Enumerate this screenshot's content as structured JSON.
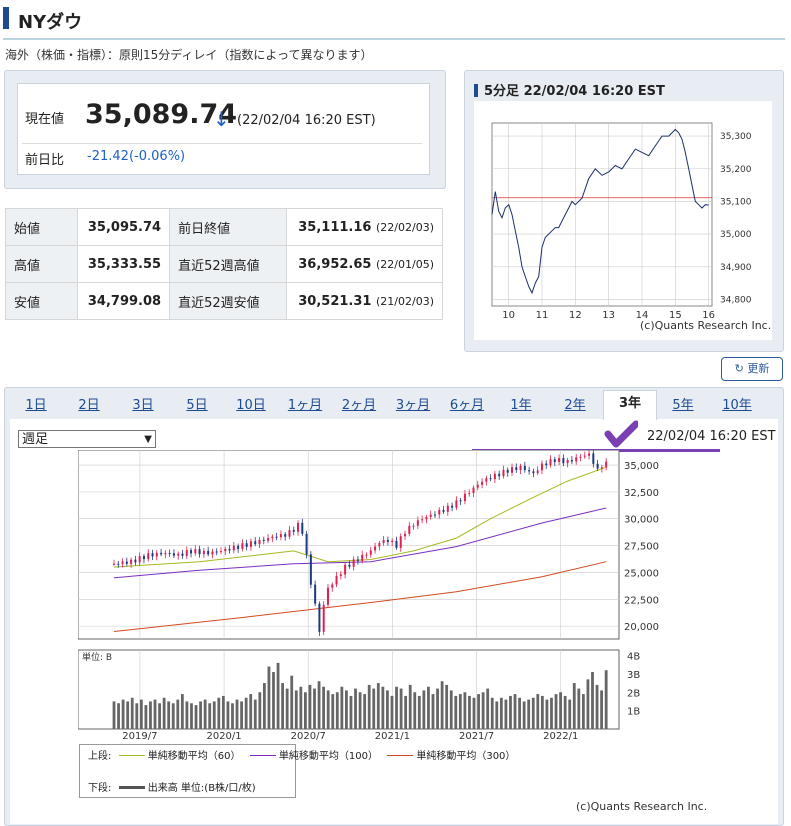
{
  "header": {
    "title": "NYダウ"
  },
  "note": "海外（株価・指標）：原則15分ディレイ（指数によって異なります）",
  "price": {
    "label_current": "現在値",
    "value": "35,089.74",
    "arrow": "↓",
    "timestamp": "(22/02/04 16:20 EST)",
    "label_change": "前日比",
    "change": "-21.42",
    "change_pct": "(-0.06%)"
  },
  "stats": {
    "open_label": "始値",
    "open": "35,095.74",
    "prev_close_label": "前日終値",
    "prev_close": "35,111.16",
    "prev_close_date": "(22/02/03)",
    "high_label": "高値",
    "high": "35,333.55",
    "high52_label": "直近52週高値",
    "high52": "36,952.65",
    "high52_date": "(22/01/05)",
    "low_label": "安値",
    "low": "34,799.08",
    "low52_label": "直近52週安値",
    "low52": "30,521.31",
    "low52_date": "(21/02/03)"
  },
  "mini": {
    "title": "5分足 22/02/04 16:20 EST",
    "copyright": "(c)Quants Research Inc."
  },
  "refresh_label": "更新",
  "tabs": [
    "1日",
    "2日",
    "3日",
    "5日",
    "10日",
    "1ヶ月",
    "2ヶ月",
    "3ヶ月",
    "6ヶ月",
    "1年",
    "2年",
    "3年",
    "5年",
    "10年"
  ],
  "active_tab": "3年",
  "period_select": "週足",
  "main_timestamp": "22/02/04 16:20 EST",
  "unit_label": "単位: B",
  "legend": {
    "upper": "上段:",
    "ma60": "単純移動平均（60）",
    "ma100": "単純移動平均（100）",
    "ma300": "単純移動平均（300）",
    "lower": "下段:",
    "volume": "出来高 単位:(B株/口/枚)"
  },
  "main_copyright": "(c)Quants Research Inc.",
  "colors": {
    "accent": "#1e4a8f",
    "up": "#e0204f",
    "down": "#1c3a80",
    "ma60": "#a8b820",
    "ma100": "#7a2fc0",
    "ma300": "#d24a1e",
    "mark": "#7a3fb2"
  },
  "chart_data": [
    {
      "type": "line",
      "title": "5分足 22/02/04 16:20 EST",
      "x": [
        9.5,
        9.6,
        9.7,
        9.8,
        9.9,
        10.0,
        10.1,
        10.2,
        10.3,
        10.4,
        10.5,
        10.6,
        10.7,
        10.8,
        10.9,
        11.0,
        11.1,
        11.2,
        11.3,
        11.4,
        11.5,
        11.6,
        11.7,
        11.8,
        11.9,
        12.0,
        12.2,
        12.4,
        12.6,
        12.8,
        13.0,
        13.2,
        13.4,
        13.6,
        13.8,
        14.0,
        14.2,
        14.4,
        14.6,
        14.8,
        15.0,
        15.1,
        15.2,
        15.3,
        15.4,
        15.5,
        15.6,
        15.7,
        15.8,
        15.9,
        16.0
      ],
      "values": [
        35060,
        35130,
        35070,
        35050,
        35080,
        35090,
        35060,
        35010,
        34960,
        34900,
        34870,
        34840,
        34820,
        34850,
        34870,
        34960,
        34990,
        35000,
        35010,
        35020,
        35020,
        35040,
        35060,
        35080,
        35100,
        35090,
        35110,
        35170,
        35200,
        35180,
        35190,
        35210,
        35200,
        35230,
        35260,
        35250,
        35240,
        35270,
        35300,
        35300,
        35320,
        35310,
        35290,
        35250,
        35200,
        35150,
        35100,
        35090,
        35080,
        35090,
        35089
      ],
      "reference_line": 35111.16,
      "xticks": [
        "10",
        "11",
        "12",
        "13",
        "14",
        "15",
        "16"
      ],
      "yticks": [
        "35,300",
        "35,200",
        "35,100",
        "35,000",
        "34,900",
        "34,800"
      ],
      "ylim": [
        34780,
        35340
      ]
    },
    {
      "type": "candlestick",
      "xticks": [
        "2019/7",
        "2020/1",
        "2020/7",
        "2021/1",
        "2021/7",
        "2022/1"
      ],
      "yticks": [
        "35,000",
        "32,500",
        "30,000",
        "27,500",
        "25,000",
        "22,500",
        "20,000"
      ],
      "ylim": [
        18800,
        36400
      ],
      "price_points": [
        [
          0,
          25800
        ],
        [
          8,
          26000
        ],
        [
          16,
          26600
        ],
        [
          24,
          26800
        ],
        [
          30,
          26600
        ],
        [
          36,
          27000
        ],
        [
          44,
          26800
        ],
        [
          52,
          27100
        ],
        [
          60,
          27500
        ],
        [
          68,
          27900
        ],
        [
          74,
          28300
        ],
        [
          80,
          28500
        ],
        [
          84,
          29000
        ],
        [
          86,
          29400
        ],
        [
          88,
          28800
        ],
        [
          90,
          26500
        ],
        [
          92,
          24000
        ],
        [
          94,
          22000
        ],
        [
          96,
          19500
        ],
        [
          98,
          22000
        ],
        [
          100,
          23500
        ],
        [
          104,
          24500
        ],
        [
          108,
          25500
        ],
        [
          112,
          26000
        ],
        [
          116,
          26500
        ],
        [
          120,
          27000
        ],
        [
          124,
          27800
        ],
        [
          128,
          28000
        ],
        [
          132,
          27500
        ],
        [
          136,
          28800
        ],
        [
          140,
          29500
        ],
        [
          144,
          30000
        ],
        [
          150,
          30500
        ],
        [
          156,
          31000
        ],
        [
          160,
          31500
        ],
        [
          166,
          32500
        ],
        [
          172,
          33500
        ],
        [
          178,
          34000
        ],
        [
          184,
          34500
        ],
        [
          190,
          34800
        ],
        [
          196,
          34200
        ],
        [
          200,
          35000
        ],
        [
          206,
          35500
        ],
        [
          212,
          35300
        ],
        [
          218,
          35800
        ],
        [
          222,
          36000
        ],
        [
          226,
          34500
        ],
        [
          228,
          35000
        ],
        [
          230,
          35100
        ]
      ],
      "ma60": [
        [
          0,
          25500
        ],
        [
          40,
          26000
        ],
        [
          84,
          27000
        ],
        [
          100,
          26000
        ],
        [
          120,
          26200
        ],
        [
          140,
          27000
        ],
        [
          160,
          28200
        ],
        [
          176,
          30000
        ],
        [
          196,
          32000
        ],
        [
          212,
          33500
        ],
        [
          230,
          34800
        ]
      ],
      "ma100": [
        [
          0,
          24500
        ],
        [
          40,
          25200
        ],
        [
          84,
          25800
        ],
        [
          120,
          26000
        ],
        [
          160,
          27400
        ],
        [
          200,
          29600
        ],
        [
          230,
          31000
        ]
      ],
      "ma300": [
        [
          0,
          19500
        ],
        [
          60,
          20800
        ],
        [
          120,
          22200
        ],
        [
          160,
          23200
        ],
        [
          200,
          24600
        ],
        [
          230,
          26000
        ]
      ],
      "volume_yticks": [
        "4B",
        "3B",
        "2B",
        "1B"
      ],
      "volume": [
        1.5,
        1.4,
        1.6,
        1.5,
        1.7,
        1.4,
        1.6,
        1.3,
        1.5,
        1.6,
        1.4,
        1.7,
        1.5,
        1.4,
        1.6,
        1.9,
        1.5,
        1.4,
        1.3,
        1.5,
        1.6,
        1.4,
        1.5,
        1.7,
        1.8,
        1.5,
        1.4,
        1.6,
        1.5,
        1.7,
        1.9,
        1.6,
        2.0,
        2.5,
        3.4,
        3.1,
        3.6,
        2.5,
        2.2,
        2.9,
        2.1,
        2.3,
        2.0,
        2.4,
        2.2,
        2.6,
        2.3,
        2.1,
        1.9,
        2.0,
        2.3,
        2.1,
        1.8,
        2.2,
        2.0,
        1.9,
        2.4,
        2.2,
        2.5,
        2.3,
        2.1,
        1.8,
        2.3,
        2.2,
        1.8,
        2.4,
        2.0,
        1.8,
        2.1,
        2.3,
        1.9,
        2.2,
        2.6,
        2.4,
        2.1,
        1.8,
        1.9,
        2.0,
        1.8,
        1.7,
        1.9,
        2.0,
        2.2,
        1.7,
        1.5,
        1.7,
        1.6,
        1.8,
        1.9,
        1.7,
        1.5,
        1.6,
        1.7,
        1.9,
        1.8,
        1.6,
        1.7,
        1.9,
        2.0,
        1.8,
        1.6,
        2.5,
        2.2,
        1.9,
        2.7,
        3.1,
        2.4,
        2.1,
        3.2
      ]
    }
  ]
}
